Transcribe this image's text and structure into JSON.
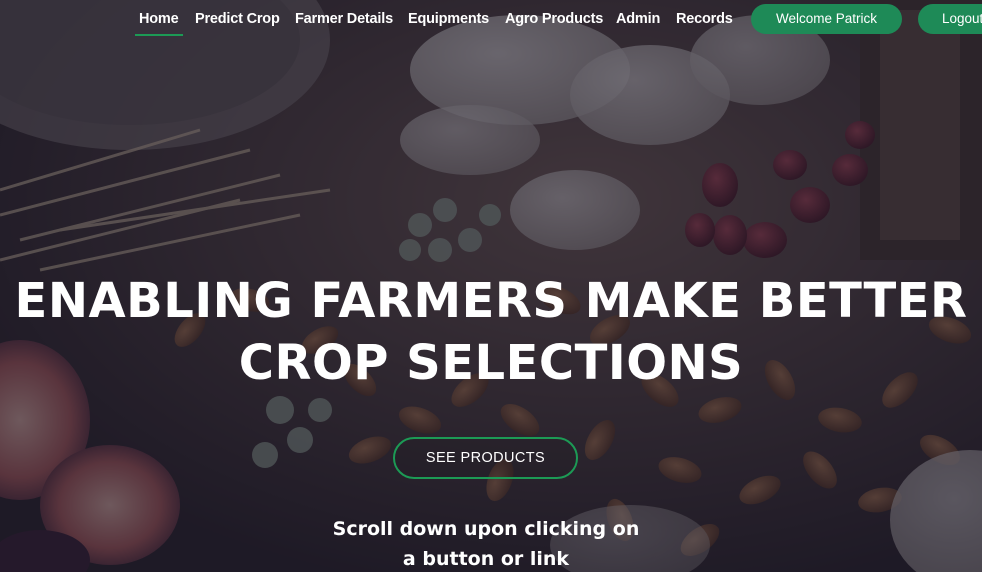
{
  "nav": {
    "items": [
      {
        "label": "Home",
        "active": true
      },
      {
        "label": "Predict Crop"
      },
      {
        "label": "Farmer Details"
      },
      {
        "label": "Equipments"
      },
      {
        "label": "Agro Products"
      },
      {
        "label": "Admin"
      },
      {
        "label": "Records"
      }
    ],
    "welcome_label": "Welcome Patrick",
    "logout_label": "Logout"
  },
  "hero": {
    "headline_line1": "ENABLING FARMERS MAKE BETTER",
    "headline_line2": "CROP SELECTIONS",
    "cta_label": "SEE PRODUCTS",
    "scroll_line1": "Scroll down upon clicking on",
    "scroll_line2": "a button or link"
  },
  "colors": {
    "accent": "#1e8a57",
    "active_underline": "#1c9a55",
    "overlay": "#161428"
  },
  "background": "food-ingredients-photo"
}
